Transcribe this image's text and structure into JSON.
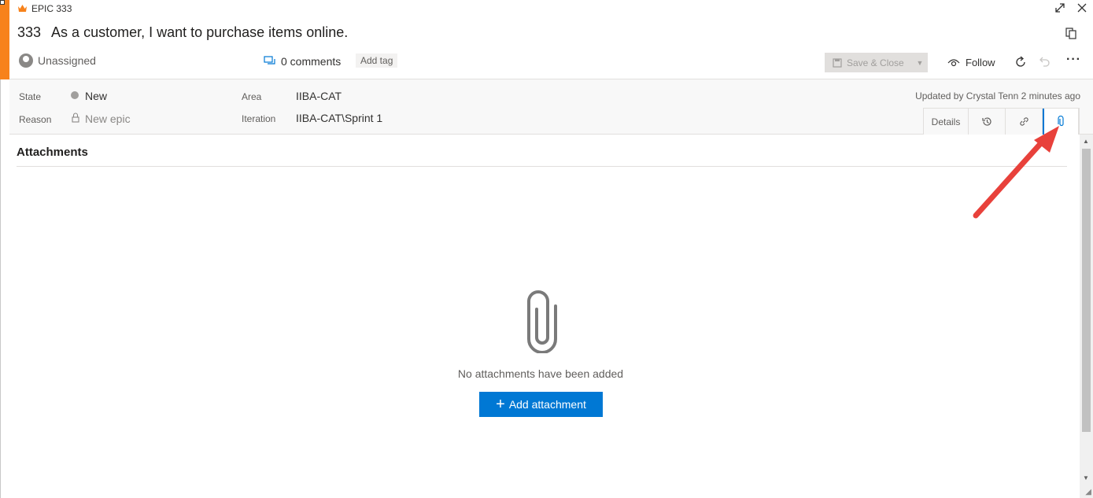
{
  "work_item": {
    "type_label": "EPIC 333",
    "id": "333",
    "title": "As a customer, I want to purchase items online.",
    "assigned_to": "Unassigned",
    "comments": "0 comments",
    "add_tag": "Add tag",
    "accent_color": "#f7821b"
  },
  "toolbar": {
    "save_close": "Save & Close",
    "follow": "Follow"
  },
  "fields": {
    "state_label": "State",
    "state_value": "New",
    "reason_label": "Reason",
    "reason_value": "New epic",
    "area_label": "Area",
    "area_value": "IIBA-CAT",
    "iteration_label": "Iteration",
    "iteration_value": "IIBA-CAT\\Sprint 1",
    "updated": "Updated by Crystal Tenn 2 minutes ago"
  },
  "tabs": {
    "details": "Details",
    "history_icon": "history-icon",
    "links_icon": "link-icon",
    "attachments_icon": "paperclip-icon"
  },
  "attachments": {
    "heading": "Attachments",
    "empty_message": "No attachments have been added",
    "add_button": "Add attachment"
  },
  "colors": {
    "primary": "#0078d4",
    "annotation_arrow": "#e8413b"
  }
}
